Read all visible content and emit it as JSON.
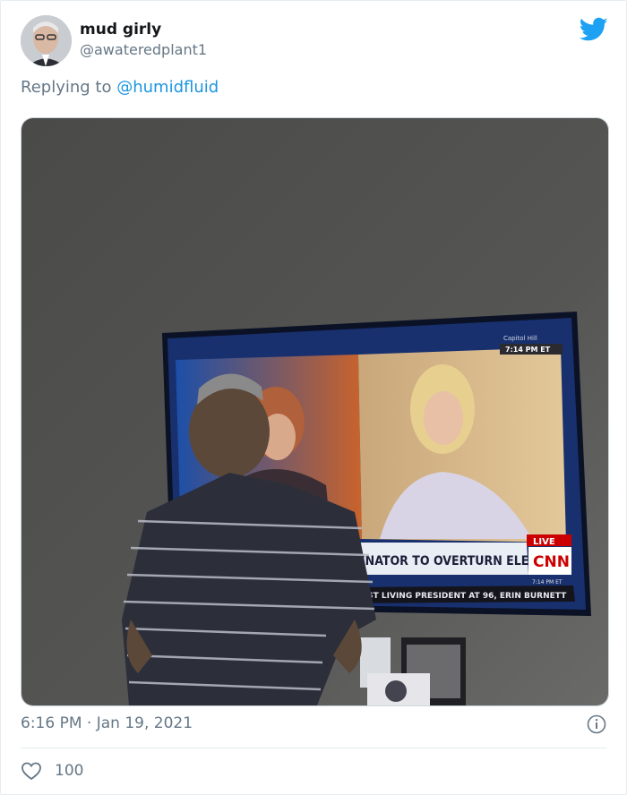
{
  "tweet": {
    "display_name": "mud girly",
    "handle": "@awateredplant1",
    "replying_prefix": "Replying to",
    "replying_to": "@humidfluid",
    "timestamp": "6:16 PM · Jan 19, 2021",
    "like_count": "100"
  },
  "tv": {
    "chyron": "SENATOR TO OVERTURN ELECTION",
    "ticker": "EST LIVING PRESIDENT AT 96, ERIN BURNETT",
    "live_badge": "LIVE",
    "network_logo": "CNN",
    "corner_location": "Capitol Hill",
    "corner_time": "7:14 PM ET",
    "small_time": "7:14 PM ET"
  },
  "icons": {
    "brand": "twitter-bird-icon",
    "info": "info-icon",
    "like": "heart-icon"
  },
  "colors": {
    "twitter_blue": "#1da1f2",
    "link_blue": "#1b95e0",
    "secondary_text": "#657786",
    "border": "#e6ecf0"
  }
}
